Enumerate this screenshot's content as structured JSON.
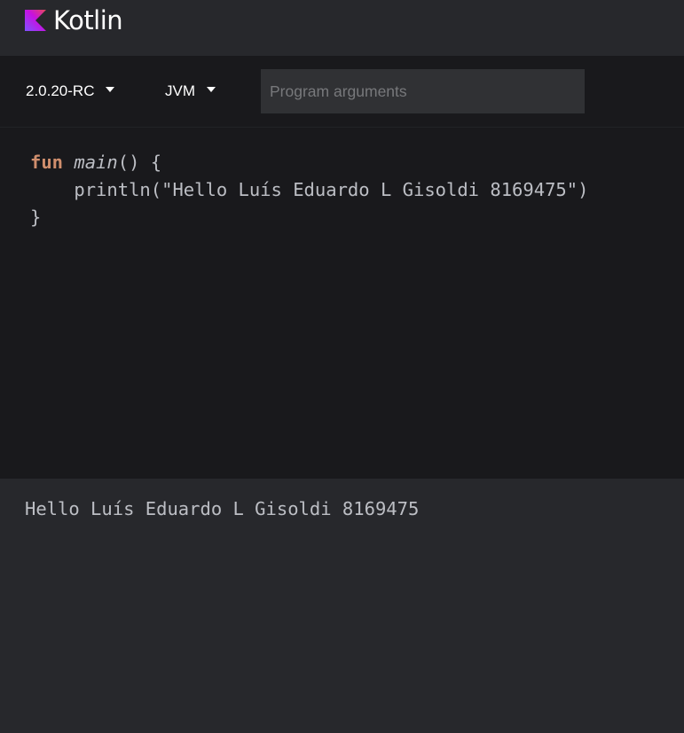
{
  "brand": {
    "name": "Kotlin",
    "logo_icon": "kotlin-logo-icon",
    "gradient_colors": [
      "#7f52ff",
      "#c711e1",
      "#e44857"
    ]
  },
  "toolbar": {
    "version_label": "2.0.20-RC",
    "platform_label": "JVM",
    "program_args": {
      "value": "",
      "placeholder": "Program arguments"
    }
  },
  "editor": {
    "lines": [
      {
        "keyword": "fun",
        "function": "main",
        "rest": "() {"
      },
      {
        "text": "    println(\"Hello Luís Eduardo L Gisoldi 8169475\")"
      },
      {
        "text": "}"
      }
    ],
    "colors": {
      "keyword": "#cf8e6d",
      "text": "#bcbec4",
      "background": "#19191c"
    }
  },
  "output": {
    "text": "Hello Luís Eduardo L Gisoldi 8169475"
  }
}
